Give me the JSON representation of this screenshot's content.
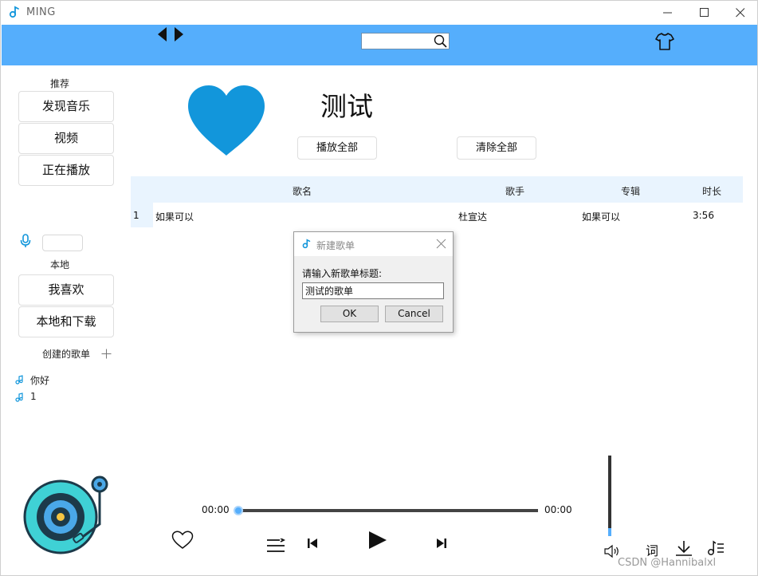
{
  "window": {
    "title": "MING"
  },
  "search": {
    "value": "",
    "placeholder": ""
  },
  "sidebar": {
    "recommend_label": "推荐",
    "recommend_items": [
      {
        "label": "发现音乐"
      },
      {
        "label": "视频"
      },
      {
        "label": "正在播放"
      }
    ],
    "local_label": "本地",
    "local_items": [
      {
        "label": "我喜欢"
      },
      {
        "label": "本地和下载"
      }
    ],
    "created_label": "创建的歌单",
    "playlists": [
      {
        "label": "你好"
      },
      {
        "label": "1"
      }
    ]
  },
  "main": {
    "playlist_title": "测试",
    "play_all": "播放全部",
    "clear_all": "清除全部",
    "columns": {
      "title": "歌名",
      "artist": "歌手",
      "album": "专辑",
      "duration": "时长"
    },
    "songs": [
      {
        "index": "1",
        "title": "如果可以",
        "artist": "杜宣达",
        "album": "如果可以",
        "duration": "3:56"
      }
    ]
  },
  "dialog": {
    "title": "新建歌单",
    "prompt": "请输入新歌单标题:",
    "input_value": "测试的歌单",
    "ok": "OK",
    "cancel": "Cancel"
  },
  "player": {
    "current_time": "00:00",
    "total_time": "00:00",
    "progress": 0,
    "volume": 0.1,
    "lyrics_label": "词"
  },
  "watermark": "CSDN @Hannibalxl",
  "colors": {
    "header": "#55aefc",
    "accent": "#1296db",
    "table_header": "#e9f4fe"
  },
  "icons": [
    "app-icon",
    "nav-back-icon",
    "nav-forward-icon",
    "search-icon",
    "shirt-icon",
    "microphone-icon",
    "plus-icon",
    "music-note-icon",
    "heart-icon",
    "shuffle-list-icon",
    "previous-icon",
    "play-icon",
    "next-icon",
    "volume-icon",
    "download-icon",
    "playlist-icon",
    "turntable-icon"
  ]
}
